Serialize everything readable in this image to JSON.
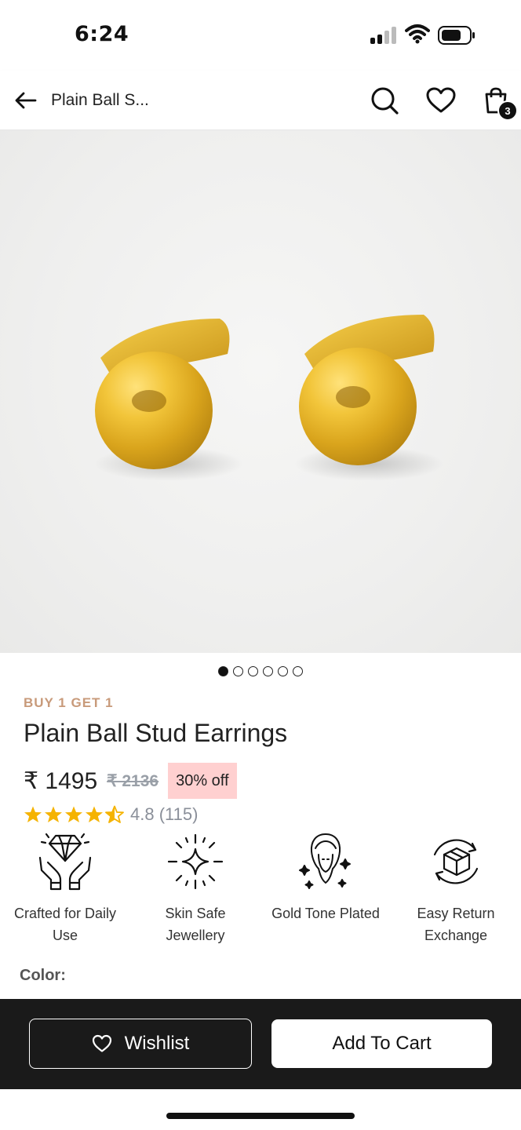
{
  "status_bar": {
    "time": "6:24",
    "signal_icon": "cellular-signal-icon",
    "wifi_icon": "wifi-icon",
    "battery_icon": "battery-icon"
  },
  "header": {
    "back_icon": "arrow-left-icon",
    "title": "Plain Ball S...",
    "search_icon": "search-icon",
    "wishlist_icon": "heart-icon",
    "cart_icon": "shopping-bag-icon",
    "cart_count": "3"
  },
  "product": {
    "image_alt_icon": "gold-ball-stud-earrings-image",
    "promo": "BUY 1 GET 1",
    "title": "Plain Ball Stud Earrings",
    "price": "₹ 1495",
    "mrp": "₹ 2136",
    "discount": "30% off",
    "rating": 4.8,
    "rating_text": "4.8 (115)",
    "star_color": "#f5b301"
  },
  "carousel": {
    "total": 6,
    "active_index": 0
  },
  "features": [
    {
      "icon": "diamond-hands-icon",
      "label": "Crafted for Daily Use"
    },
    {
      "icon": "sparkle-icon",
      "label": "Skin Safe Jewellery"
    },
    {
      "icon": "woman-sparkles-icon",
      "label": "Gold Tone Plated"
    },
    {
      "icon": "box-return-icon",
      "label": "Easy Return Exchange"
    }
  ],
  "color": {
    "label": "Color:"
  },
  "actions": {
    "wishlist_label": "Wishlist",
    "add_to_cart_label": "Add To Cart"
  },
  "colors": {
    "promo": "#c89a7a",
    "discount_bg": "#ffd0d0",
    "bottom_bar": "#1a1a1a"
  }
}
